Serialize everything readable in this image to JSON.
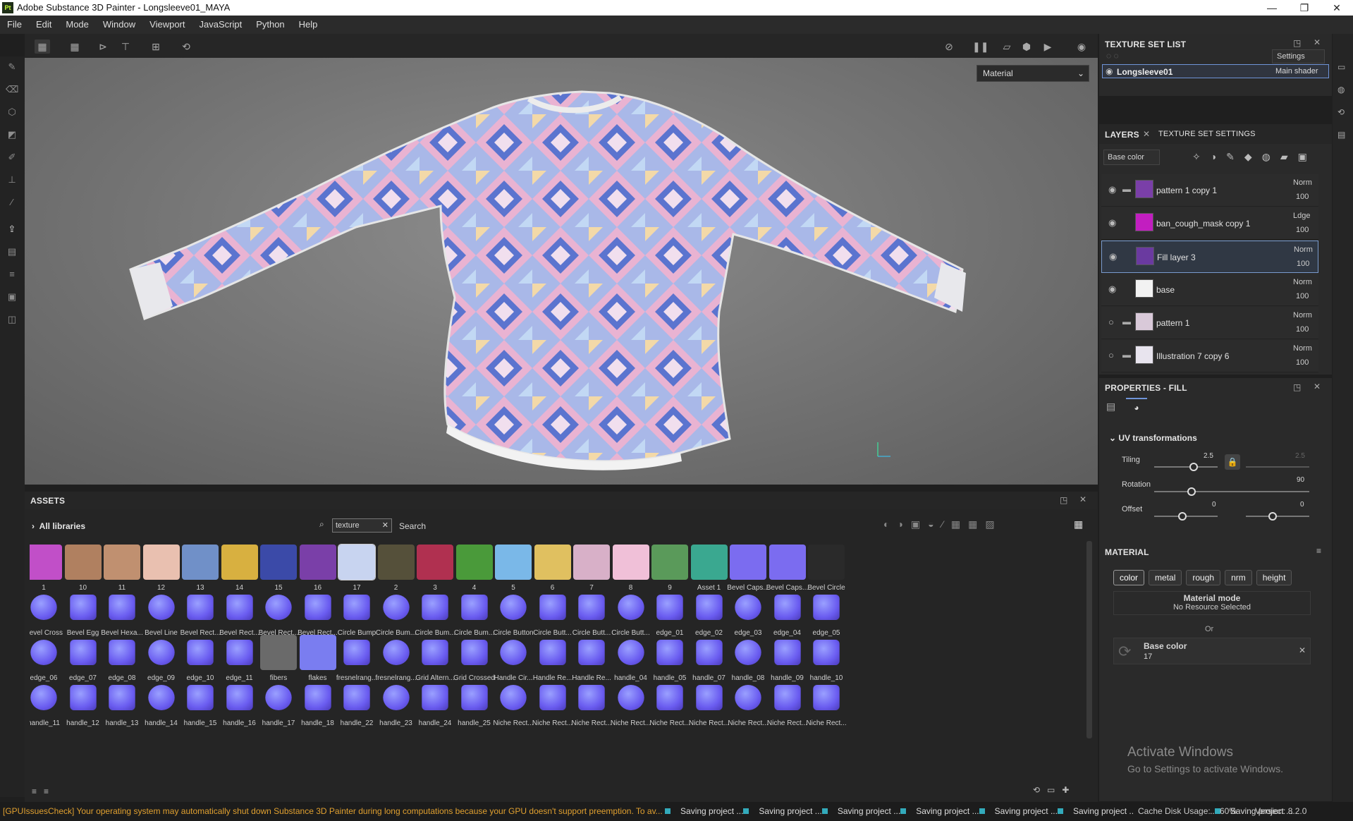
{
  "window": {
    "app_title": "Adobe Substance 3D Painter - Longsleeve01_MAYA",
    "minimize": "—",
    "maximize": "❐",
    "close": "✕",
    "logo": "Pt"
  },
  "menu": [
    "File",
    "Edit",
    "Mode",
    "Window",
    "Viewport",
    "JavaScript",
    "Python",
    "Help"
  ],
  "viewport": {
    "mode_select": "Material",
    "mode_arrow": "⌄"
  },
  "texture_set_list": {
    "title": "TEXTURE SET LIST",
    "settings": "Settings",
    "set_name": "Longsleeve01",
    "shader": "Main shader"
  },
  "layers_panel": {
    "tab_layers": "LAYERS",
    "tab_tss": "TEXTURE SET SETTINGS",
    "channel": "Base color",
    "layers": [
      {
        "name": "pattern 1 copy 1",
        "blend": "Norm",
        "opacity": "100",
        "folder": true,
        "visible": true,
        "thumb": "#7a3fa8"
      },
      {
        "name": "ban_cough_mask copy 1",
        "blend": "Ldge",
        "opacity": "100",
        "folder": false,
        "visible": true,
        "thumb": "#c21ec0"
      },
      {
        "name": "Fill layer 3",
        "blend": "Norm",
        "opacity": "100",
        "folder": false,
        "visible": true,
        "thumb": "#6a3aa0",
        "selected": true
      },
      {
        "name": "base",
        "blend": "Norm",
        "opacity": "100",
        "folder": false,
        "visible": true,
        "thumb": "#f2f2f2"
      },
      {
        "name": "pattern 1",
        "blend": "Norm",
        "opacity": "100",
        "folder": true,
        "visible": false,
        "thumb": "#d9c9d9"
      },
      {
        "name": "Illustration 7 copy 6",
        "blend": "Norm",
        "opacity": "100",
        "folder": true,
        "visible": false,
        "thumb": "#e8e4ee"
      }
    ]
  },
  "properties": {
    "title": "PROPERTIES - FILL",
    "uv_title": "UV transformations",
    "tiling_label": "Tiling",
    "tiling_value": "2.5",
    "tiling_value2": "2.5",
    "rotation_label": "Rotation",
    "rotation_value": "90",
    "offset_label": "Offset",
    "offset_value": "0",
    "offset_value2": "0",
    "material_title": "MATERIAL",
    "channels": [
      "color",
      "metal",
      "rough",
      "nrm",
      "height"
    ],
    "material_mode_label": "Material mode",
    "material_mode_value": "No Resource Selected",
    "or": "Or",
    "base_color_label": "Base color",
    "base_color_value": "17"
  },
  "assets": {
    "title": "ASSETS",
    "all_libraries": "All libraries",
    "search_value": "texture",
    "search_label": "Search",
    "rows": [
      [
        "1",
        "10",
        "11",
        "12",
        "13",
        "14",
        "15",
        "16",
        "17",
        "2",
        "3",
        "4",
        "5",
        "6",
        "7",
        "8",
        "9",
        "Asset 1",
        "Bevel Caps...",
        "Bevel Caps...",
        "Bevel Circle"
      ],
      [
        "Bevel Cross",
        "Bevel Egg",
        "Bevel Hexa...",
        "Bevel Line",
        "Bevel Rect...",
        "Bevel Rect...",
        "Bevel Rect...",
        "Bevel Rect...",
        "Circle Bump",
        "Circle Bum...",
        "Circle Bum...",
        "Circle Bum...",
        "Circle Button",
        "Circle Butt...",
        "Circle Butt...",
        "Circle Butt...",
        "edge_01",
        "edge_02",
        "edge_03",
        "edge_04",
        "edge_05"
      ],
      [
        "edge_06",
        "edge_07",
        "edge_08",
        "edge_09",
        "edge_10",
        "edge_11",
        "fibers",
        "flakes",
        "fresnelrang...",
        "fresnelrang...",
        "Grid Altern...",
        "Grid Crossed",
        "Handle Cir...",
        "Handle Re...",
        "Handle Re...",
        "handle_04",
        "handle_05",
        "handle_07",
        "handle_08",
        "handle_09",
        "handle_10"
      ],
      [
        "handle_11",
        "handle_12",
        "handle_13",
        "handle_14",
        "handle_15",
        "handle_16",
        "handle_17",
        "handle_18",
        "handle_22",
        "handle_23",
        "handle_24",
        "handle_25",
        "Niche Rect...",
        "Niche Rect...",
        "Niche Rect...",
        "Niche Rect...",
        "Niche Rect...",
        "Niche Rect...",
        "Niche Rect...",
        "Niche Rect...",
        "Niche Rect..."
      ]
    ]
  },
  "status": {
    "warning": "[GPUIssuesCheck] Your operating system may automatically shut down Substance 3D Painter during long computations because your GPU doesn't support preemption. To av...",
    "saving": [
      "Saving project ...",
      "Saving project ...",
      "Saving project ...",
      "Saving project ...",
      "Saving project ...",
      "Saving project ...",
      "Saving project ...",
      "Saving project ..."
    ],
    "cache": "Cache Disk Usage:",
    "cache_value": "60%",
    "version": "Version: 8.2.0"
  },
  "watermark": {
    "line1": "Activate Windows",
    "line2": "Go to Settings to activate Windows."
  },
  "colors": {
    "accent": "#6f94d8",
    "statusbar_warning": "#e0a030"
  }
}
